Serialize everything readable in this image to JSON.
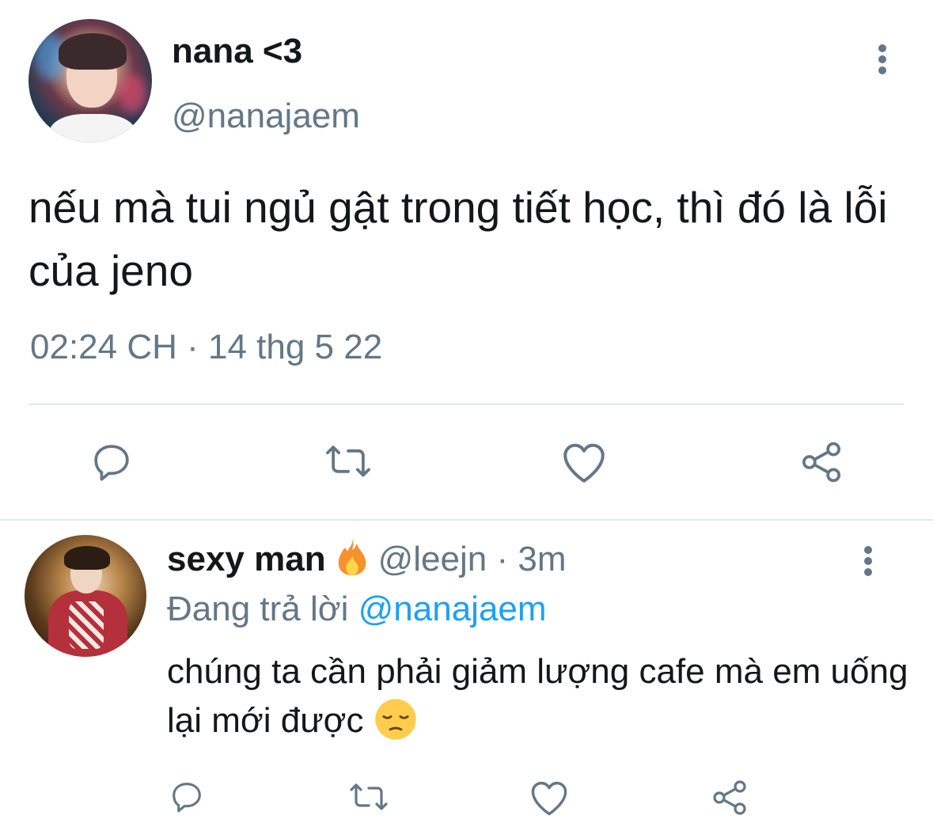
{
  "main_tweet": {
    "display_name": "nana <3",
    "handle": "@nanajaem",
    "text": "nếu mà tui ngủ gật trong tiết học, thì đó là lỗi của jeno",
    "timestamp": "02:24 CH · 14 thg 5 22",
    "avatar_icon": "user-avatar",
    "more_icon": "more-vertical-icon",
    "actions": [
      {
        "name": "reply",
        "icon": "comment-icon"
      },
      {
        "name": "retweet",
        "icon": "retweet-icon"
      },
      {
        "name": "like",
        "icon": "heart-icon"
      },
      {
        "name": "share",
        "icon": "share-icon"
      }
    ]
  },
  "reply": {
    "display_name": "sexy man",
    "name_emoji": "fire-emoji",
    "handle": "@leejn",
    "separator": "·",
    "time": "3m",
    "replying_label": "Đang trả lời",
    "replying_to": "@nanajaem",
    "text": "chúng ta cần phải giảm lượng cafe mà em uống lại mới được",
    "text_emoji": "pensive-face-emoji"
  },
  "colors": {
    "text_primary": "#14171a",
    "text_secondary": "#657786",
    "link": "#1da1f2",
    "divider": "#e1e8ed",
    "background": "#ffffff"
  }
}
